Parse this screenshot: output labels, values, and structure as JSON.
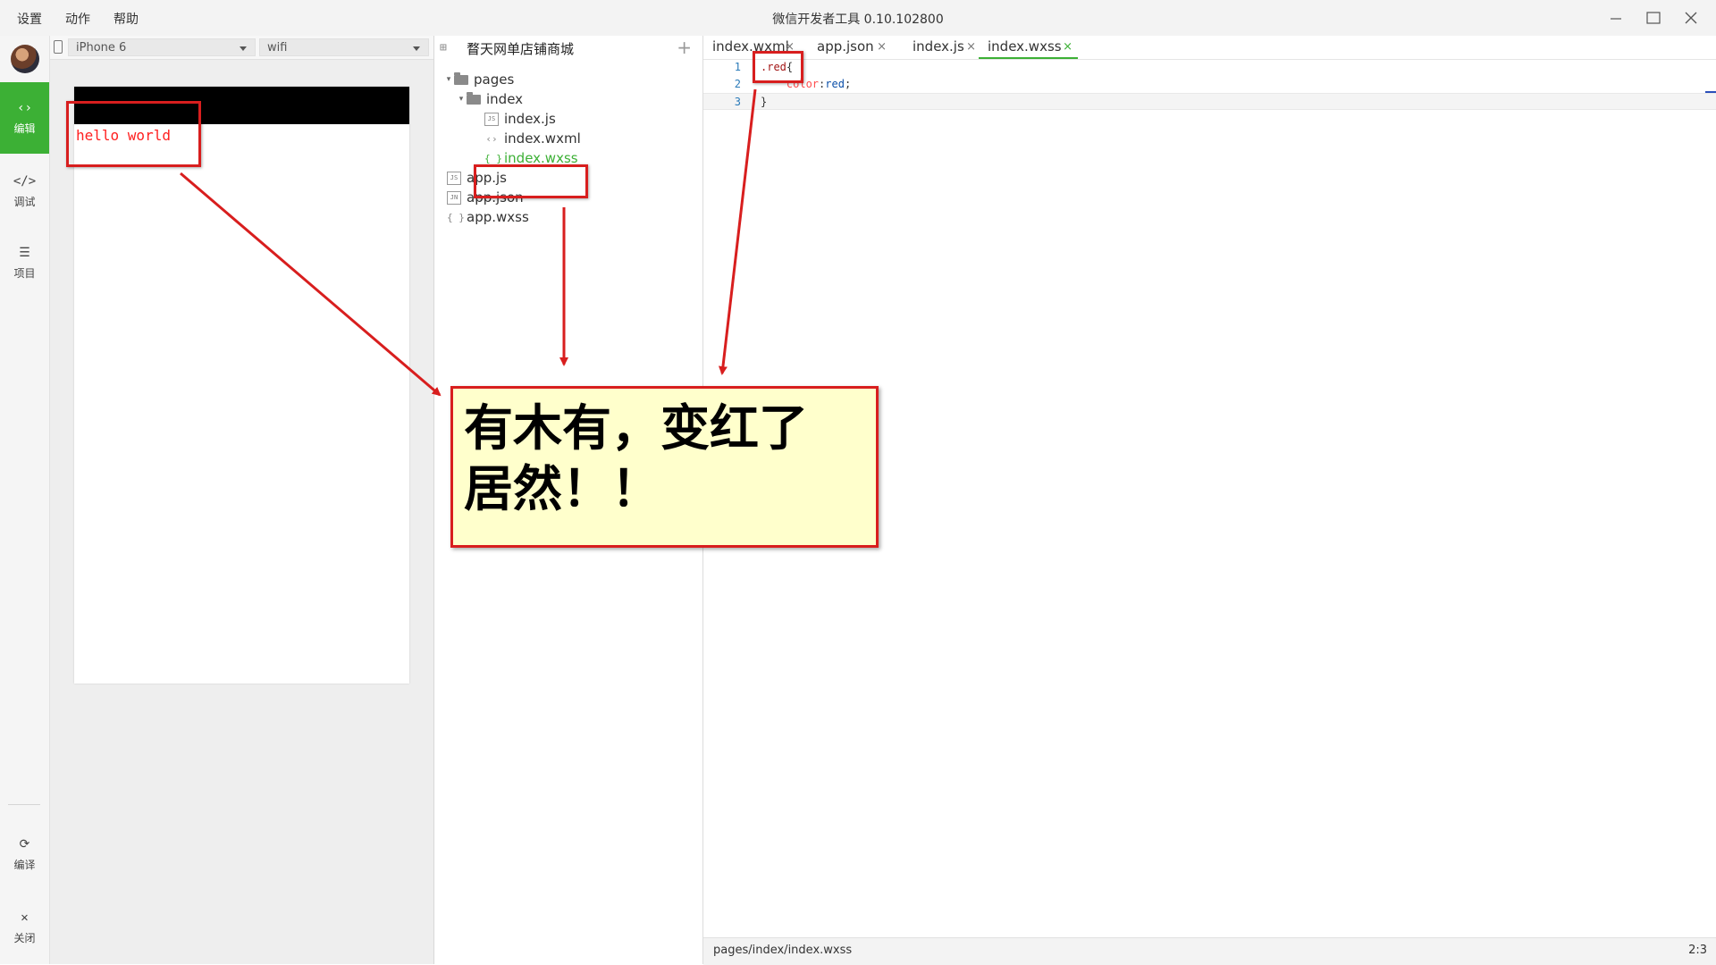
{
  "window": {
    "title": "微信开发者工具 0.10.102800",
    "menu": [
      "设置",
      "动作",
      "帮助"
    ]
  },
  "sidebar": {
    "items": [
      {
        "label": "编辑",
        "glyph": "‹›"
      },
      {
        "label": "调试",
        "glyph": "</>"
      },
      {
        "label": "项目",
        "glyph": "☰"
      },
      {
        "label": "编译",
        "glyph": "⟳"
      },
      {
        "label": "关闭",
        "glyph": "✕"
      }
    ]
  },
  "simulator": {
    "device": "iPhone 6",
    "network": "wifi",
    "content_text": "hello world"
  },
  "tree": {
    "project_name": "瞀天网单店铺商城",
    "items": [
      {
        "label": "pages",
        "icon": ""
      },
      {
        "label": "index",
        "icon": ""
      },
      {
        "label": "index.js",
        "icon": "JS"
      },
      {
        "label": "index.wxml",
        "icon": "‹›"
      },
      {
        "label": "index.wxss",
        "icon": "{ }"
      },
      {
        "label": "app.js",
        "icon": "JS"
      },
      {
        "label": "app.json",
        "icon": "JN"
      },
      {
        "label": "app.wxss",
        "icon": "{ }"
      }
    ]
  },
  "editor": {
    "tabs": [
      {
        "label": "index.wxml"
      },
      {
        "label": "app.json"
      },
      {
        "label": "index.js"
      },
      {
        "label": "index.wxss"
      }
    ],
    "lines": [
      {
        "num": "1",
        "parts": [
          ".red",
          "{"
        ]
      },
      {
        "num": "2",
        "parts": [
          "color",
          ":",
          "red",
          ";"
        ]
      },
      {
        "num": "3",
        "parts": [
          "}"
        ]
      }
    ],
    "status_path": "pages/index/index.wxss",
    "status_pos": "2:3"
  },
  "annotation": {
    "line1": "有木有，变红了",
    "line2": "居然！！"
  },
  "colors": {
    "accent": "#3cb035",
    "annotation_red": "#d81e1e",
    "note_bg": "#ffffcc"
  }
}
